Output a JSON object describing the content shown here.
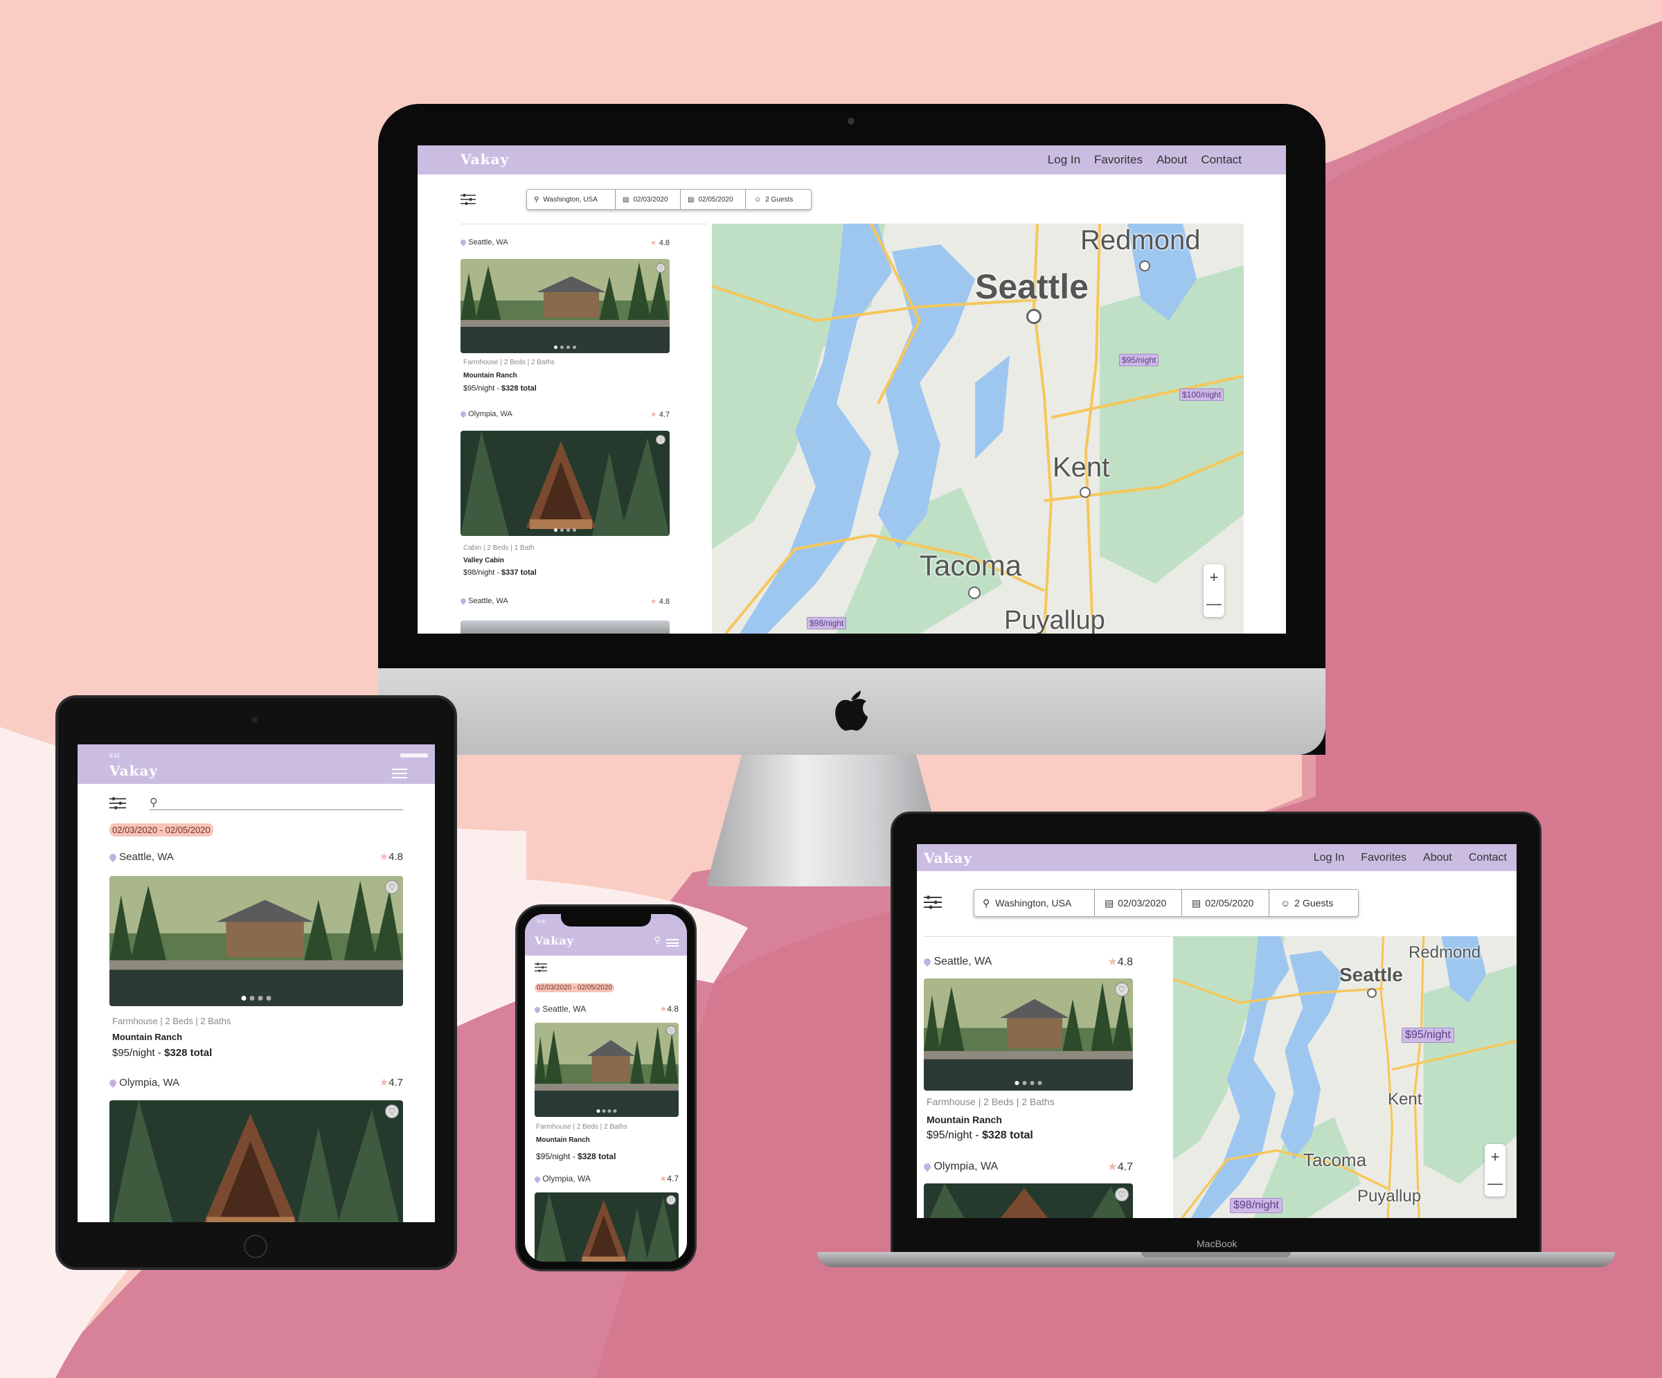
{
  "app": {
    "logo": "Vakay"
  },
  "nav": {
    "login": "Log In",
    "favorites": "Favorites",
    "about": "About",
    "contact": "Contact"
  },
  "search": {
    "location": "Washington, USA",
    "checkin": "02/03/2020",
    "checkout": "02/05/2020",
    "guests": "2 Guests"
  },
  "date_chip": "02/03/2020 - 02/05/2020",
  "status": {
    "time": "9:41"
  },
  "listings": [
    {
      "location": "Seattle, WA",
      "rating": "4.8",
      "meta": "Farmhouse | 2 Beds | 2 Baths",
      "title": "Mountain Ranch",
      "price": "$95/night - ",
      "total": "$328 total"
    },
    {
      "location": "Olympia, WA",
      "rating": "4.7",
      "meta": "Cabin | 2 Beds | 1 Bath",
      "title": "Valley Cabin",
      "price": "$98/night - ",
      "total": "$337 total"
    },
    {
      "location": "Seattle, WA",
      "rating": "4.8"
    }
  ],
  "map": {
    "cities": {
      "redmond": "Redmond",
      "seattle": "Seattle",
      "kent": "Kent",
      "tacoma": "Tacoma",
      "puyallup": "Puyallup"
    },
    "price_tags": [
      "$95/night",
      "$100/night",
      "$98/night"
    ]
  },
  "laptop": {
    "label": "MacBook"
  },
  "icons": {
    "search": "search-icon",
    "calendar": "calendar-icon",
    "guest": "person-icon",
    "filter": "filter-sliders-icon",
    "heart": "heart-icon",
    "pin": "location-pin-icon",
    "star": "star-icon",
    "menu": "hamburger-menu-icon",
    "apple": "apple-logo-icon"
  },
  "colors": {
    "nav": "#cbbde2",
    "accent_star": "#f2b8ae",
    "chip": "#f6c4b8",
    "background_light": "#f9cdc3",
    "background_dark": "#d4728a"
  }
}
